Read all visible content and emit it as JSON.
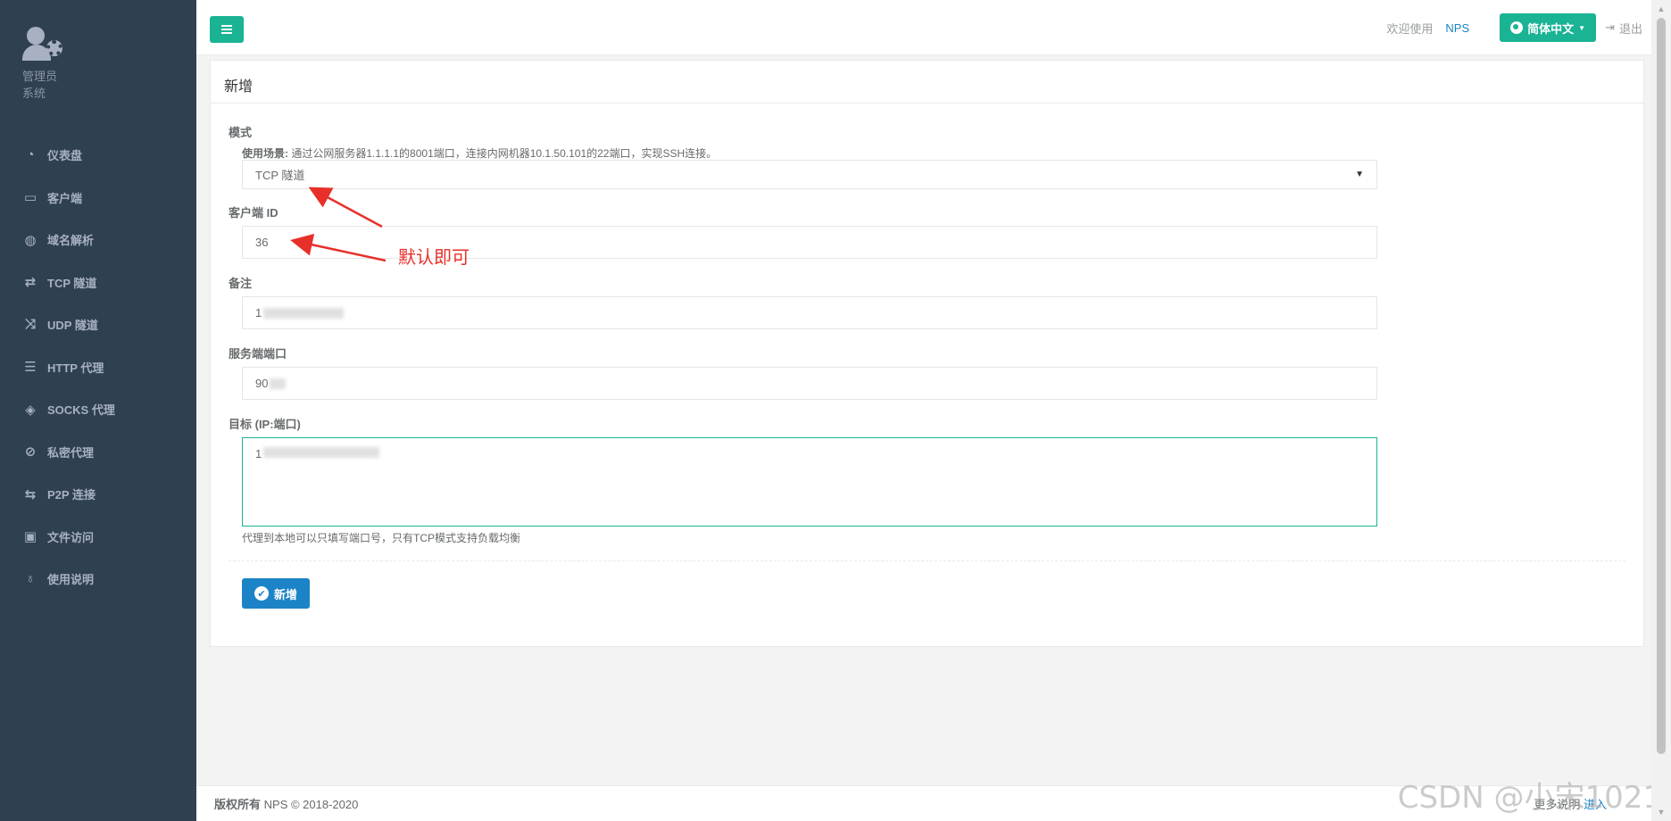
{
  "sidebar": {
    "role_line1": "管理员",
    "role_line2": "系统",
    "items": [
      {
        "label": "仪表盘",
        "icon": "dashboard-icon"
      },
      {
        "label": "客户端",
        "icon": "desktop-icon"
      },
      {
        "label": "域名解析",
        "icon": "globe-icon"
      },
      {
        "label": "TCP 隧道",
        "icon": "retweet-icon"
      },
      {
        "label": "UDP 隧道",
        "icon": "random-icon"
      },
      {
        "label": "HTTP 代理",
        "icon": "server-icon"
      },
      {
        "label": "SOCKS 代理",
        "icon": "layers-icon"
      },
      {
        "label": "私密代理",
        "icon": "eye-slash-icon"
      },
      {
        "label": "P2P 连接",
        "icon": "exchange-icon"
      },
      {
        "label": "文件访问",
        "icon": "briefcase-icon"
      },
      {
        "label": "使用说明",
        "icon": "lightbulb-icon"
      }
    ]
  },
  "topbar": {
    "welcome": "欢迎使用",
    "brand": "NPS",
    "language": "简体中文",
    "logout": "退出"
  },
  "form": {
    "title": "新增",
    "mode_label": "模式",
    "usage_prefix": "使用场景:",
    "usage_text": "通过公网服务器1.1.1.1的8001端口，连接内网机器10.1.50.101的22端口，实现SSH连接。",
    "mode_value": "TCP 隧道",
    "client_id_label": "客户端 ID",
    "client_id_value": "36",
    "remark_label": "备注",
    "remark_value": "1",
    "server_port_label": "服务端端口",
    "server_port_value": "90",
    "target_label": "目标 (IP:端口)",
    "target_value": "1",
    "target_help": "代理到本地可以只填写端口号，只有TCP模式支持负载均衡",
    "submit_label": "新增"
  },
  "annotation": {
    "text": "默认即可",
    "color": "#e8302a"
  },
  "footer": {
    "copyright_bold": "版权所有",
    "copyright_rest": "NPS © 2018-2020",
    "more": "更多说明",
    "enter": "进入"
  },
  "watermark": "CSDN @小宋1021",
  "colors": {
    "sidebar_bg": "#2f4050",
    "primary": "#1ab394",
    "link": "#1c84c6"
  }
}
